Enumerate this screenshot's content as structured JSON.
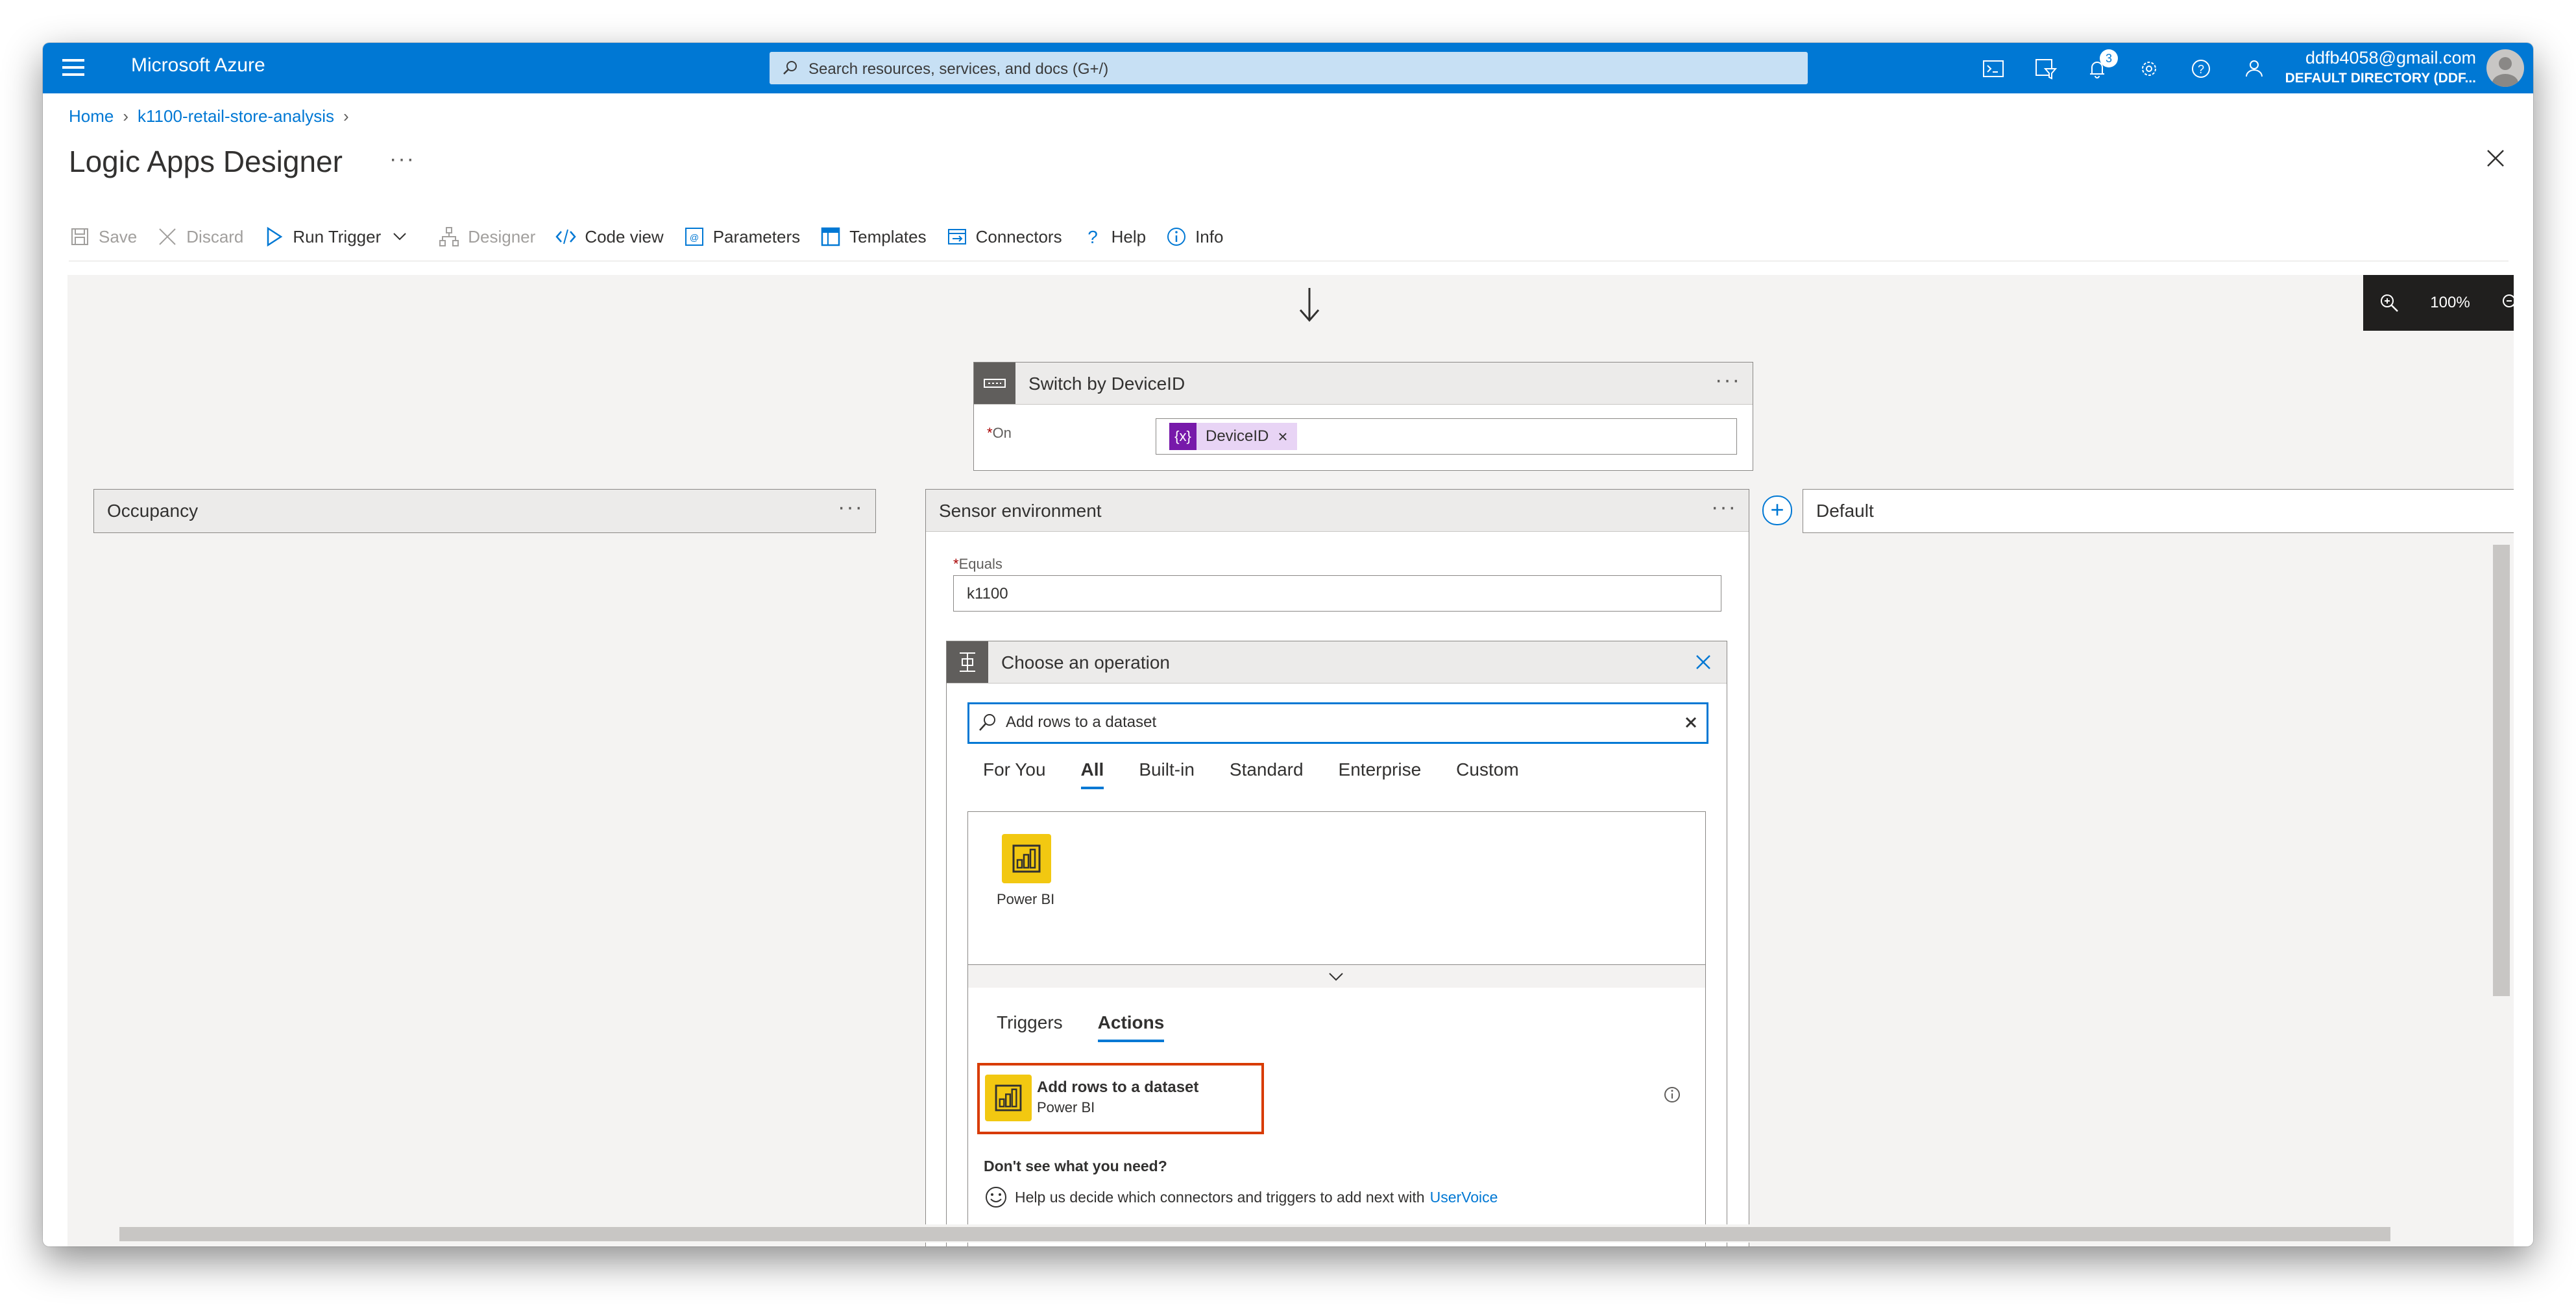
{
  "topbar": {
    "brand": "Microsoft Azure",
    "search_placeholder": "Search resources, services, and docs (G+/)",
    "notification_count": "3",
    "account_email": "ddfb4058@gmail.com",
    "account_directory": "DEFAULT DIRECTORY (DDF..."
  },
  "breadcrumb": {
    "home": "Home",
    "resource": "k1100-retail-store-analysis"
  },
  "page": {
    "title": "Logic Apps Designer",
    "more": "···"
  },
  "toolbar": {
    "save": "Save",
    "discard": "Discard",
    "run_trigger": "Run Trigger",
    "designer": "Designer",
    "code_view": "Code view",
    "parameters": "Parameters",
    "templates": "Templates",
    "connectors": "Connectors",
    "help": "Help",
    "info": "Info"
  },
  "zoom": {
    "level": "100%"
  },
  "switch_card": {
    "title": "Switch by DeviceID",
    "more": "···",
    "on_label": "On",
    "token_icon": "{x}",
    "token_name": "DeviceID",
    "token_remove": "×"
  },
  "branches": {
    "occupancy": "Occupancy",
    "sensor": "Sensor environment",
    "default": "Default",
    "more": "···",
    "equals_label": "Equals",
    "equals_value": "k1100"
  },
  "operation": {
    "title": "Choose an operation",
    "search_value": "Add rows to a dataset",
    "tabs": [
      "For You",
      "All",
      "Built-in",
      "Standard",
      "Enterprise",
      "Custom"
    ],
    "active_tab": "All",
    "connector_label": "Power BI",
    "sub_tabs": [
      "Triggers",
      "Actions"
    ],
    "active_sub_tab": "Actions",
    "action_name": "Add rows to a dataset",
    "action_connector": "Power BI",
    "dont_see": "Don't see what you need?",
    "help_text": "Help us decide which connectors and triggers to add next with",
    "uservoice": "UserVoice"
  },
  "colors": {
    "azure_blue": "#0078d4",
    "power_bi_yellow": "#f2c811",
    "highlight_red": "#d83b01",
    "token_purple": "#7719aa"
  }
}
